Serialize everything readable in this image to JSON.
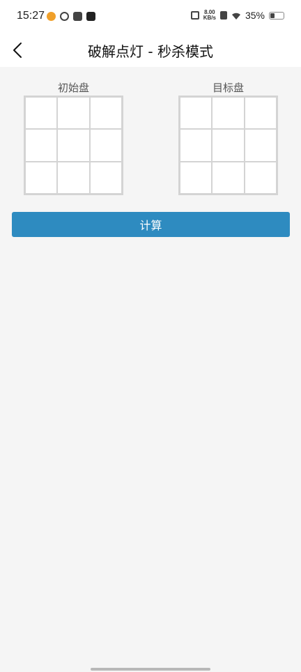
{
  "status_bar": {
    "time": "15:27",
    "netspeed_value": "8.00",
    "netspeed_unit": "KB/s",
    "battery_text": "35%",
    "battery_level": 0.35,
    "left_icons": [
      "weibo-icon",
      "ring-app-icon",
      "flower-app-icon",
      "tiktok-icon"
    ],
    "right_icons": [
      "vibrate-icon",
      "sim-icon",
      "wifi-icon",
      "battery-icon"
    ]
  },
  "app_bar": {
    "back_icon": "chevron-left-icon",
    "title": "破解点灯 - 秒杀模式"
  },
  "boards": {
    "initial": {
      "label": "初始盘",
      "rows": 3,
      "cols": 3
    },
    "target": {
      "label": "目标盘",
      "rows": 3,
      "cols": 3
    }
  },
  "actions": {
    "calculate_label": "计算"
  },
  "colors": {
    "primary": "#2e8bc0",
    "background": "#f5f5f5",
    "cell_border": "#d4d4d4"
  }
}
